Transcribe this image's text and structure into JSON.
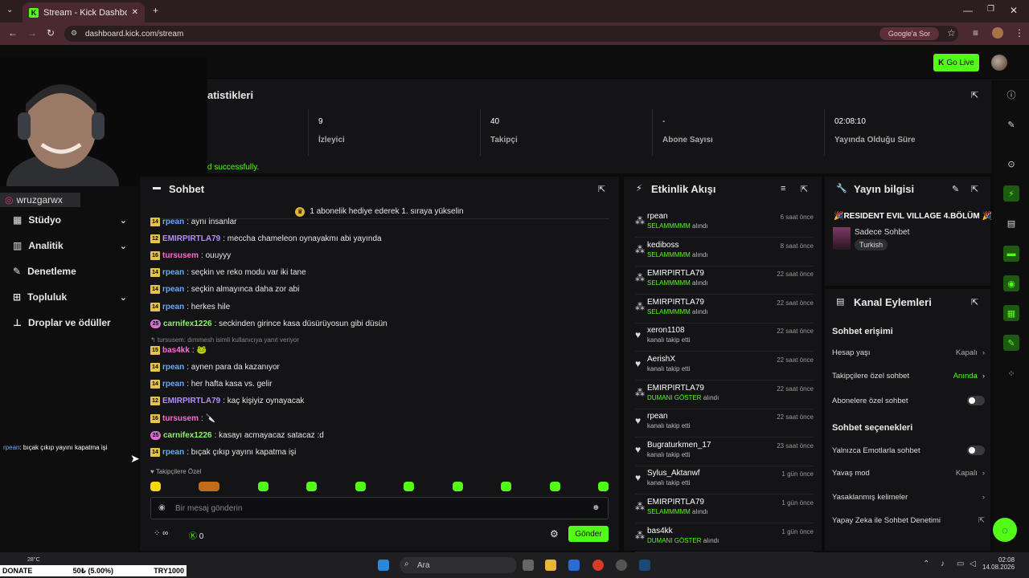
{
  "browser": {
    "tab_title": "Stream - Kick Dashboard",
    "url": "dashboard.kick.com/stream",
    "google_button": "Google'a Sor"
  },
  "topnav": {
    "go_live": "Go Live"
  },
  "webcam": {
    "handle": "wruzgarwx"
  },
  "sidebar": {
    "items": [
      "Stüdyo",
      "Analitik",
      "Denetleme",
      "Topluluk",
      "Droplar ve ödüller"
    ]
  },
  "overlay_chat": {
    "user": "rpean",
    "text": ": bıçak çıkıp yayını kapatma işi"
  },
  "stats": {
    "title": "atistikleri",
    "success": "d successfully.",
    "boxes": [
      {
        "value": "9",
        "label": "İzleyici"
      },
      {
        "value": "40",
        "label": "Takipçi"
      },
      {
        "value": "-",
        "label": "Abone Sayısı"
      },
      {
        "value": "02:08:10",
        "label": "Yayında Olduğu Süre"
      }
    ]
  },
  "chat": {
    "title": "Sohbet",
    "pinned": "1 abonelik hediye ederek 1. sıraya yükselin",
    "messages": [
      {
        "badge": "14",
        "user": "rpean",
        "color": "#6aa8ff",
        "text": ": aynı insanlar"
      },
      {
        "badge": "12",
        "user": "EMIRPIRTLA79",
        "color": "#b58cff",
        "text": ": meccha chameleon oynayakmı abi yayında"
      },
      {
        "badge": "16",
        "user": "tursusem",
        "color": "#ff6bd6",
        "text": ": ouuyyy"
      },
      {
        "badge": "14",
        "user": "rpean",
        "color": "#6aa8ff",
        "text": ": seçkin ve reko modu var iki tane"
      },
      {
        "badge": "14",
        "user": "rpean",
        "color": "#6aa8ff",
        "text": ": seçkin almayınca daha zor abi"
      },
      {
        "badge": "14",
        "user": "rpean",
        "color": "#6aa8ff",
        "text": ": herkes hile"
      },
      {
        "badge": "25",
        "user": "carnifex1226",
        "color": "#8ef26a",
        "text": ": seckinden girince kasa düsürüyosun gibi düsün"
      },
      {
        "badge": "15",
        "user": "bas4kk",
        "color": "#ff6bd6",
        "text": ": 🐸"
      },
      {
        "badge": "14",
        "user": "rpean",
        "color": "#6aa8ff",
        "text": ": aynen para da kazanıyor"
      },
      {
        "badge": "14",
        "user": "rpean",
        "color": "#6aa8ff",
        "text": ": her hafta kasa vs. gelir"
      },
      {
        "badge": "12",
        "user": "EMIRPIRTLA79",
        "color": "#b58cff",
        "text": ": kaç kişiyiz oynayacak"
      },
      {
        "badge": "16",
        "user": "tursusem",
        "color": "#ff6bd6",
        "text": ": 🔪"
      },
      {
        "badge": "25",
        "user": "carnifex1226",
        "color": "#8ef26a",
        "text": ": kasayı acmayacaz satacaz :d"
      },
      {
        "badge": "14",
        "user": "rpean",
        "color": "#6aa8ff",
        "text": ": bıçak çıkıp yayını kapatma işi"
      }
    ],
    "reply_context": "↰ tursusem: dımmesh isimli kullanıcıya yanıt veriyor",
    "followers_label": "Takipçilere Özel",
    "input_placeholder": "Bir mesaj gönderin",
    "send": "Gönder",
    "viewer_infinity": "∞",
    "coins": "0"
  },
  "activity": {
    "title": "Etkinlik Akışı",
    "items": [
      {
        "icon": "gift-icon",
        "name": "rpean",
        "highlight": "SELAMMMMM",
        "desc": " alındı",
        "time": "6 saat önce"
      },
      {
        "icon": "gift-icon",
        "name": "kediboss",
        "highlight": "SELAMMMMM",
        "desc": " alındı",
        "time": "8 saat önce"
      },
      {
        "icon": "gift-icon",
        "name": "EMIRPIRTLA79",
        "highlight": "SELAMMMMM",
        "desc": " alındı",
        "time": "22 saat önce"
      },
      {
        "icon": "gift-icon",
        "name": "EMIRPIRTLA79",
        "highlight": "SELAMMMMM",
        "desc": " alındı",
        "time": "22 saat önce"
      },
      {
        "icon": "heart-icon",
        "name": "xeron1108",
        "highlight": "",
        "desc": "kanalı takip etti",
        "time": "22 saat önce"
      },
      {
        "icon": "heart-icon",
        "name": "AerishX",
        "highlight": "",
        "desc": "kanalı takip etti",
        "time": "22 saat önce"
      },
      {
        "icon": "gift-icon",
        "name": "EMIRPIRTLA79",
        "highlight": "DUMANI GÖSTER",
        "desc": " alındı",
        "time": "22 saat önce"
      },
      {
        "icon": "heart-icon",
        "name": "rpean",
        "highlight": "",
        "desc": "kanalı takip etti",
        "time": "22 saat önce"
      },
      {
        "icon": "heart-icon",
        "name": "Bugraturkmen_17",
        "highlight": "",
        "desc": "kanalı takip etti",
        "time": "23 saat önce"
      },
      {
        "icon": "heart-icon",
        "name": "Sylus_Aktanwf",
        "highlight": "",
        "desc": "kanalı takip etti",
        "time": "1 gün önce"
      },
      {
        "icon": "gift-icon",
        "name": "EMIRPIRTLA79",
        "highlight": "SELAMMMMM",
        "desc": " alındı",
        "time": "1 gün önce"
      },
      {
        "icon": "gift-icon",
        "name": "bas4kk",
        "highlight": "DUMANI GÖSTER",
        "desc": " alındı",
        "time": "1 gün önce"
      }
    ]
  },
  "stream_info": {
    "title": "Yayın bilgisi",
    "stream_title": "🎉RESIDENT EVIL VILLAGE 4.BÖLÜM 🎉",
    "category": "Sadece Sohbet",
    "language": "Turkish"
  },
  "channel_actions": {
    "title": "Kanal Eylemleri",
    "section1": "Sohbet erişimi",
    "section2": "Sohbet seçenekleri",
    "rows": [
      {
        "label": "Hesap yaşı",
        "value": "Kapalı"
      },
      {
        "label": "Takipçilere özel sohbet",
        "value": "Anında"
      },
      {
        "label": "Abonelere özel sohbet",
        "value": ""
      },
      {
        "label": "Yalnızca Emotlarla sohbet",
        "value": ""
      },
      {
        "label": "Yavaş mod",
        "value": "Kapalı"
      },
      {
        "label": "Yasaklanmış kelimeler",
        "value": ""
      },
      {
        "label": "Yapay Zeka ile Sohbet Denetimi",
        "value": ""
      }
    ]
  },
  "taskbar": {
    "donate": "DONATE",
    "donate_amount": "50₺ (5.00%)",
    "donate_goal": "TRY1000",
    "weather": "28°C",
    "search": "Ara",
    "time": "02:08",
    "date": "14.08.2026"
  },
  "colors": {
    "accent": "#53fc18",
    "panel": "#141416",
    "background": "#0b0b0c"
  }
}
